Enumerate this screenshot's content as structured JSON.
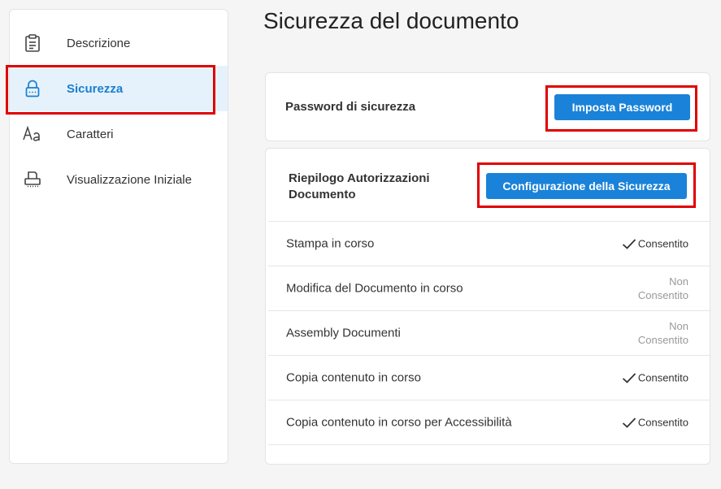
{
  "sidebar": {
    "items": [
      {
        "label": "Descrizione",
        "icon": "clipboard-icon"
      },
      {
        "label": "Sicurezza",
        "icon": "lock-icon"
      },
      {
        "label": "Caratteri",
        "icon": "font-icon"
      },
      {
        "label": "Visualizzazione Iniziale",
        "icon": "printer-icon"
      }
    ]
  },
  "page": {
    "title": "Sicurezza del documento"
  },
  "password_card": {
    "title": "Password di sicurezza",
    "button_label": "Imposta Password"
  },
  "permissions_card": {
    "title_line1": "Riepilogo Autorizzazioni",
    "title_line2": "Documento",
    "button_label": "Configurazione della Sicurezza",
    "rows": [
      {
        "label": "Stampa in corso",
        "status": "Consentito",
        "allowed": true
      },
      {
        "label": "Modifica del Documento in corso",
        "status_line1": "Non",
        "status_line2": "Consentito",
        "allowed": false
      },
      {
        "label": "Assembly Documenti",
        "status_line1": "Non",
        "status_line2": "Consentito",
        "allowed": false
      },
      {
        "label": "Copia contenuto in corso",
        "status": "Consentito",
        "allowed": true
      },
      {
        "label": "Copia contenuto in corso per Accessibilità",
        "status": "Consentito",
        "allowed": true
      }
    ]
  },
  "colors": {
    "accent": "#1a82d8",
    "active_bg": "#e6f2fb",
    "highlight": "#e00000"
  }
}
